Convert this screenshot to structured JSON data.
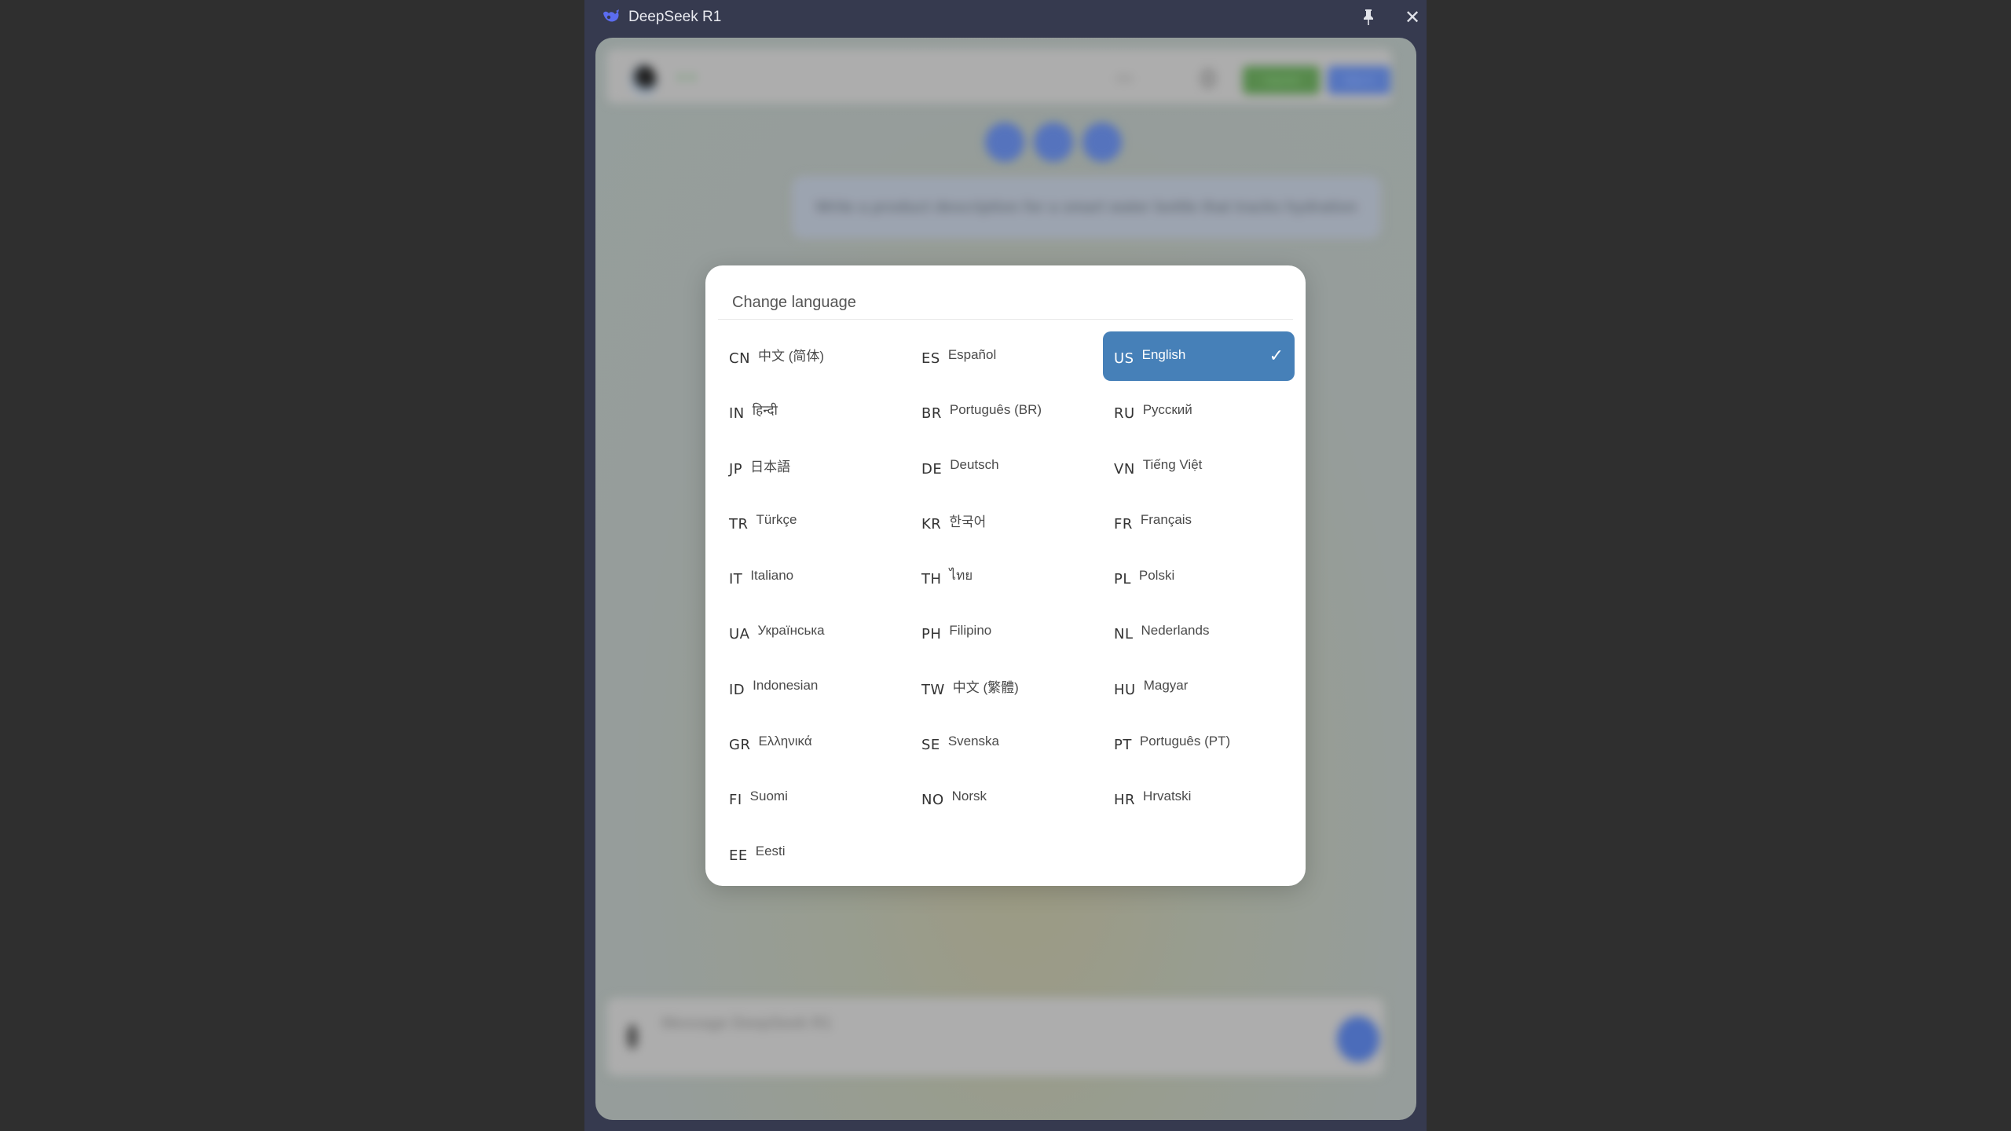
{
  "window": {
    "title": "DeepSeek R1",
    "icons": {
      "logo": "deepseek-whale-icon",
      "pin": "pin-icon",
      "close": "close-icon"
    },
    "close_glyph": "✕"
  },
  "background": {
    "header_badge": "● ●",
    "language_label": "EN",
    "green_button": "Upgrade",
    "blue_button": "Sign in",
    "user_message": "Write a product description for a smart water bottle that tracks hydration",
    "input_placeholder": "Message DeepSeek R1"
  },
  "dialog": {
    "title": "Change language",
    "selected_code": "US",
    "check_glyph": "✓",
    "languages": [
      {
        "code": "CN",
        "name": "中文 (简体)"
      },
      {
        "code": "ES",
        "name": "Español"
      },
      {
        "code": "US",
        "name": "English"
      },
      {
        "code": "IN",
        "name": "हिन्दी"
      },
      {
        "code": "BR",
        "name": "Português (BR)"
      },
      {
        "code": "RU",
        "name": "Русский"
      },
      {
        "code": "JP",
        "name": "日本語"
      },
      {
        "code": "DE",
        "name": "Deutsch"
      },
      {
        "code": "VN",
        "name": "Tiếng Việt"
      },
      {
        "code": "TR",
        "name": "Türkçe"
      },
      {
        "code": "KR",
        "name": "한국어"
      },
      {
        "code": "FR",
        "name": "Français"
      },
      {
        "code": "IT",
        "name": "Italiano"
      },
      {
        "code": "TH",
        "name": "ไทย"
      },
      {
        "code": "PL",
        "name": "Polski"
      },
      {
        "code": "UA",
        "name": "Українська"
      },
      {
        "code": "PH",
        "name": "Filipino"
      },
      {
        "code": "NL",
        "name": "Nederlands"
      },
      {
        "code": "ID",
        "name": "Indonesian"
      },
      {
        "code": "TW",
        "name": "中文 (繁體)"
      },
      {
        "code": "HU",
        "name": "Magyar"
      },
      {
        "code": "GR",
        "name": "Ελληνικά"
      },
      {
        "code": "SE",
        "name": "Svenska"
      },
      {
        "code": "PT",
        "name": "Português (PT)"
      },
      {
        "code": "FI",
        "name": "Suomi"
      },
      {
        "code": "NO",
        "name": "Norsk"
      },
      {
        "code": "HR",
        "name": "Hrvatski"
      },
      {
        "code": "EE",
        "name": "Eesti"
      }
    ]
  },
  "colors": {
    "titlebar": "#363a4f",
    "selected": "#4680b8",
    "accent_blue": "#5877c4",
    "accent_green": "#5a8f4f"
  }
}
